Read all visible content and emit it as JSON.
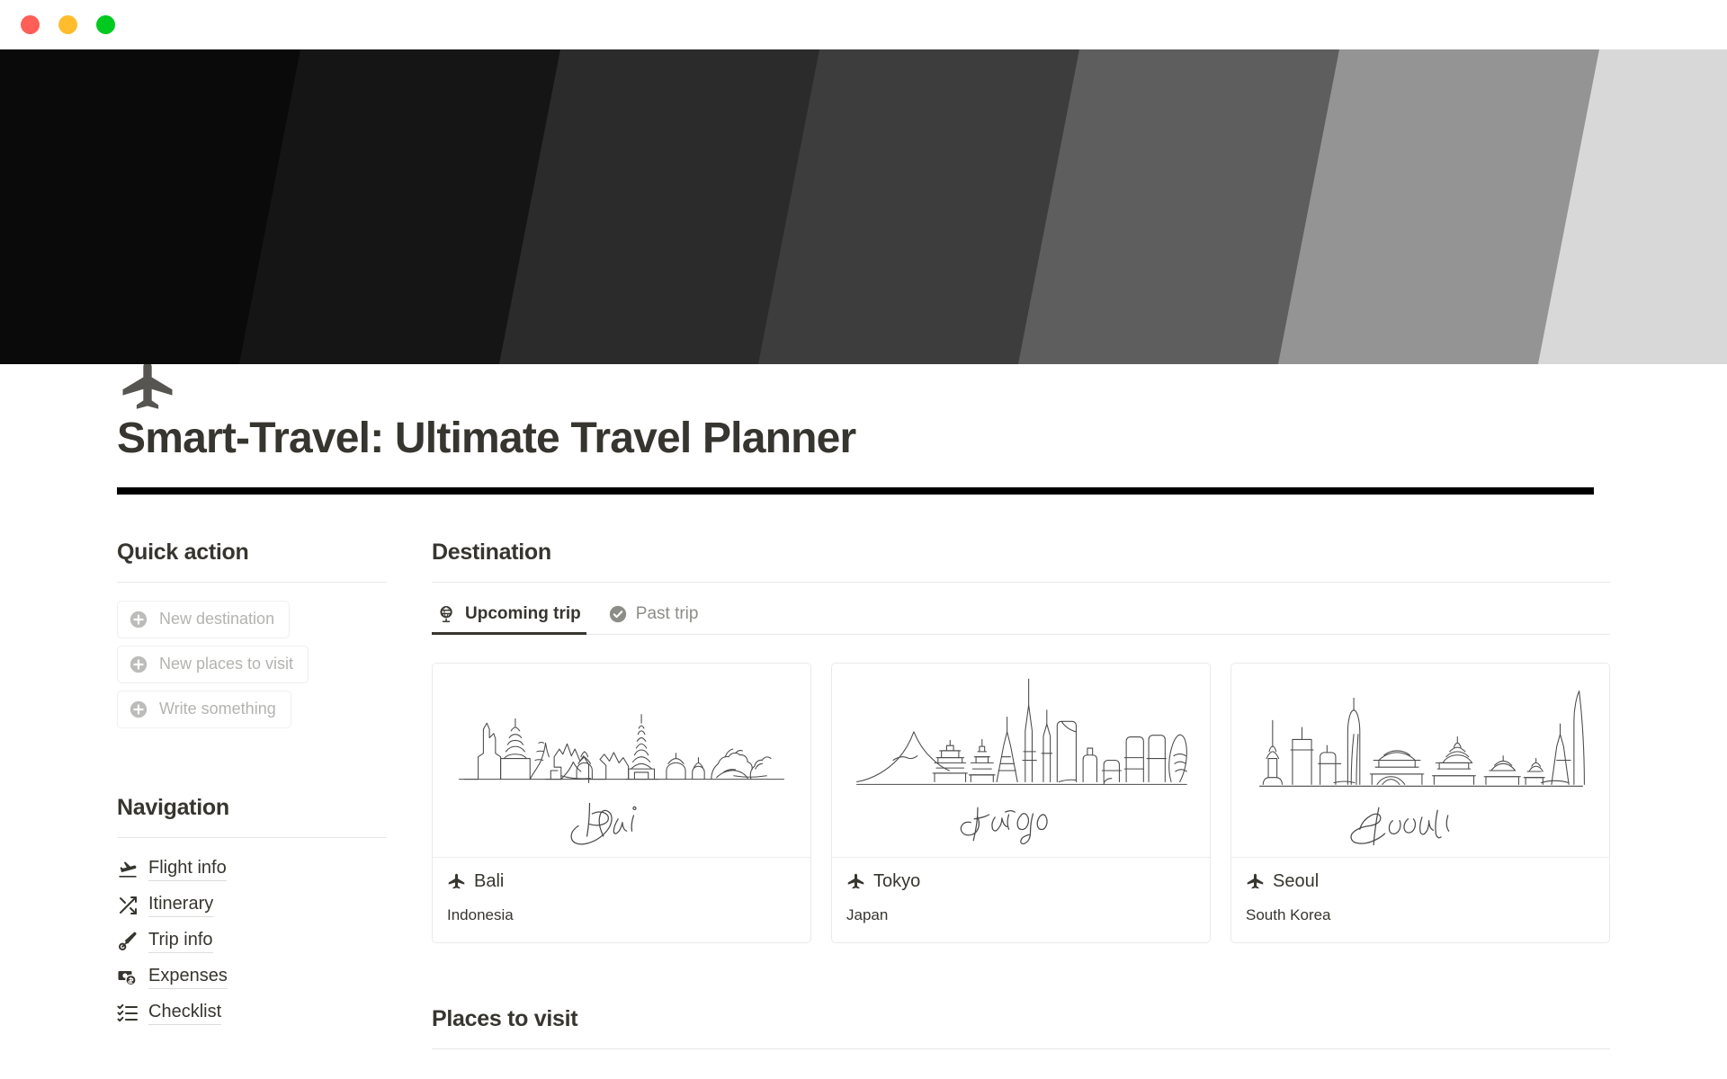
{
  "window": {
    "controls": [
      "close-button",
      "minimize-button",
      "zoom-button"
    ]
  },
  "header": {
    "hero_icon": "airplane-icon",
    "title": "Smart-Travel: Ultimate Travel Planner",
    "banner_colors": [
      "#0a0a0a",
      "#151515",
      "#2b2b2b",
      "#3d3d3d",
      "#5e5e5e",
      "#949494",
      "#d8d8d8"
    ]
  },
  "sidebar": {
    "quick_action": {
      "heading": "Quick action",
      "items": [
        {
          "label": "New destination",
          "icon": "plus-circle-icon"
        },
        {
          "label": "New places to visit",
          "icon": "plus-circle-icon"
        },
        {
          "label": "Write something",
          "icon": "plus-circle-icon"
        }
      ]
    },
    "navigation": {
      "heading": "Navigation",
      "items": [
        {
          "label": "Flight info",
          "icon": "flight-takeoff-icon"
        },
        {
          "label": "Itinerary",
          "icon": "shuffle-icon"
        },
        {
          "label": "Trip info",
          "icon": "paintbrush-icon"
        },
        {
          "label": "Expenses",
          "icon": "money-icon"
        },
        {
          "label": "Checklist",
          "icon": "checklist-icon"
        }
      ]
    }
  },
  "main": {
    "destination": {
      "heading": "Destination",
      "tabs": [
        {
          "label": "Upcoming trip",
          "icon": "globe-icon",
          "active": true
        },
        {
          "label": "Past trip",
          "icon": "check-circle-icon",
          "active": false
        }
      ],
      "cards": [
        {
          "name": "Bali",
          "country": "Indonesia",
          "script_label": "Bali",
          "icon": "airplane-icon",
          "art": "bali-skyline-line-art"
        },
        {
          "name": "Tokyo",
          "country": "Japan",
          "script_label": "Tokyo",
          "icon": "airplane-icon",
          "art": "tokyo-skyline-line-art"
        },
        {
          "name": "Seoul",
          "country": "South Korea",
          "script_label": "Seoul",
          "icon": "airplane-icon",
          "art": "seoul-skyline-line-art"
        }
      ]
    },
    "places": {
      "heading": "Places to visit"
    }
  },
  "colors": {
    "text": "#37352f",
    "muted": "#b3b3b0",
    "rule": "#e8e8e6",
    "accent": "#000000"
  }
}
